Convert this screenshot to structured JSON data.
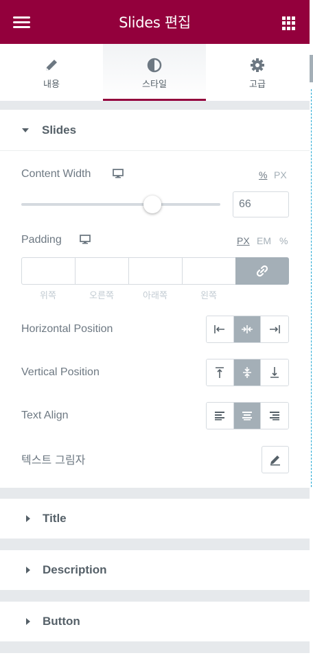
{
  "header": {
    "title": "Slides 편집",
    "menu_icon": "hamburger-icon",
    "apps_icon": "grid-icon"
  },
  "tabs": [
    {
      "label": "내용",
      "icon": "pencil-icon",
      "active": false
    },
    {
      "label": "스타일",
      "icon": "contrast-icon",
      "active": true
    },
    {
      "label": "고급",
      "icon": "gear-icon",
      "active": false
    }
  ],
  "slides_section": {
    "title": "Slides",
    "content_width": {
      "label": "Content Width",
      "units": [
        "%",
        "PX"
      ],
      "selected_unit": "%",
      "value": "66",
      "slider_fraction": 0.66
    },
    "padding": {
      "label": "Padding",
      "units": [
        "PX",
        "EM",
        "%"
      ],
      "selected_unit": "PX",
      "sides": [
        "위쪽",
        "오른쪽",
        "아래쪽",
        "왼쪽"
      ]
    },
    "horizontal_position": {
      "label": "Horizontal Position",
      "selected": "center"
    },
    "vertical_position": {
      "label": "Vertical Position",
      "selected": "middle"
    },
    "text_align": {
      "label": "Text Align",
      "selected": "center"
    },
    "text_shadow": {
      "label": "텍스트 그림자"
    }
  },
  "collapsed_sections": [
    "Title",
    "Description",
    "Button"
  ],
  "colors": {
    "brand": "#93003c",
    "active_choice": "#a4afb7"
  }
}
